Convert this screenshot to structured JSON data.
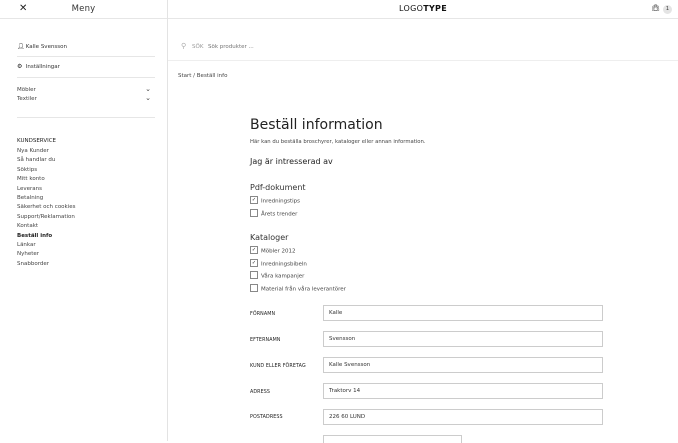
{
  "menu": {
    "title": "Meny",
    "user": "Kalle Svensson",
    "settings": "Inställningar",
    "categories": [
      "Möbler",
      "Textiler"
    ],
    "customer_service_heading": "KUNDSERVICE",
    "customer_service_items": [
      "Nya Kunder",
      "Så handlar du",
      "Söktips",
      "Mitt konto",
      "Leverans",
      "Betalning",
      "Säkerhet och cookies",
      "Support/Reklamation",
      "Kontakt",
      "Beställ info",
      "Länkar",
      "Nyheter",
      "Snabborder"
    ]
  },
  "header": {
    "logo_light": "LOGO",
    "logo_bold": "TYPE",
    "cart_count": "1"
  },
  "search": {
    "label": "SÖK",
    "placeholder": "Sök produkter ..."
  },
  "breadcrumb": "Start / Beställ info",
  "main": {
    "title": "Beställ information",
    "intro": "Här kan du beställa broschyrer, kataloger eller annan information.",
    "interest_heading": "Jag är intresserad av",
    "pdf_heading": "Pdf-dokument",
    "pdf_items": [
      {
        "label": "Inredningstips",
        "checked": true
      },
      {
        "label": "Årets trender",
        "checked": false
      }
    ],
    "catalog_heading": "Kataloger",
    "catalog_items": [
      {
        "label": "Möbler 2012",
        "checked": true
      },
      {
        "label": "Inredningsbibeln",
        "checked": true
      },
      {
        "label": "Våra kampanjer",
        "checked": false
      },
      {
        "label": "Material från våra leverantörer",
        "checked": false
      }
    ],
    "form": [
      {
        "label": "FÖRNAMN",
        "value": "Kalle"
      },
      {
        "label": "EFTERNAMN",
        "value": "Svensson"
      },
      {
        "label": "KUND ELLER FÖRETAG",
        "value": "Kalle Svensson"
      },
      {
        "label": "ADRESS",
        "value": "Traktorv 14"
      },
      {
        "label": "POSTADRESS",
        "value": "226 60 LUND"
      }
    ]
  }
}
